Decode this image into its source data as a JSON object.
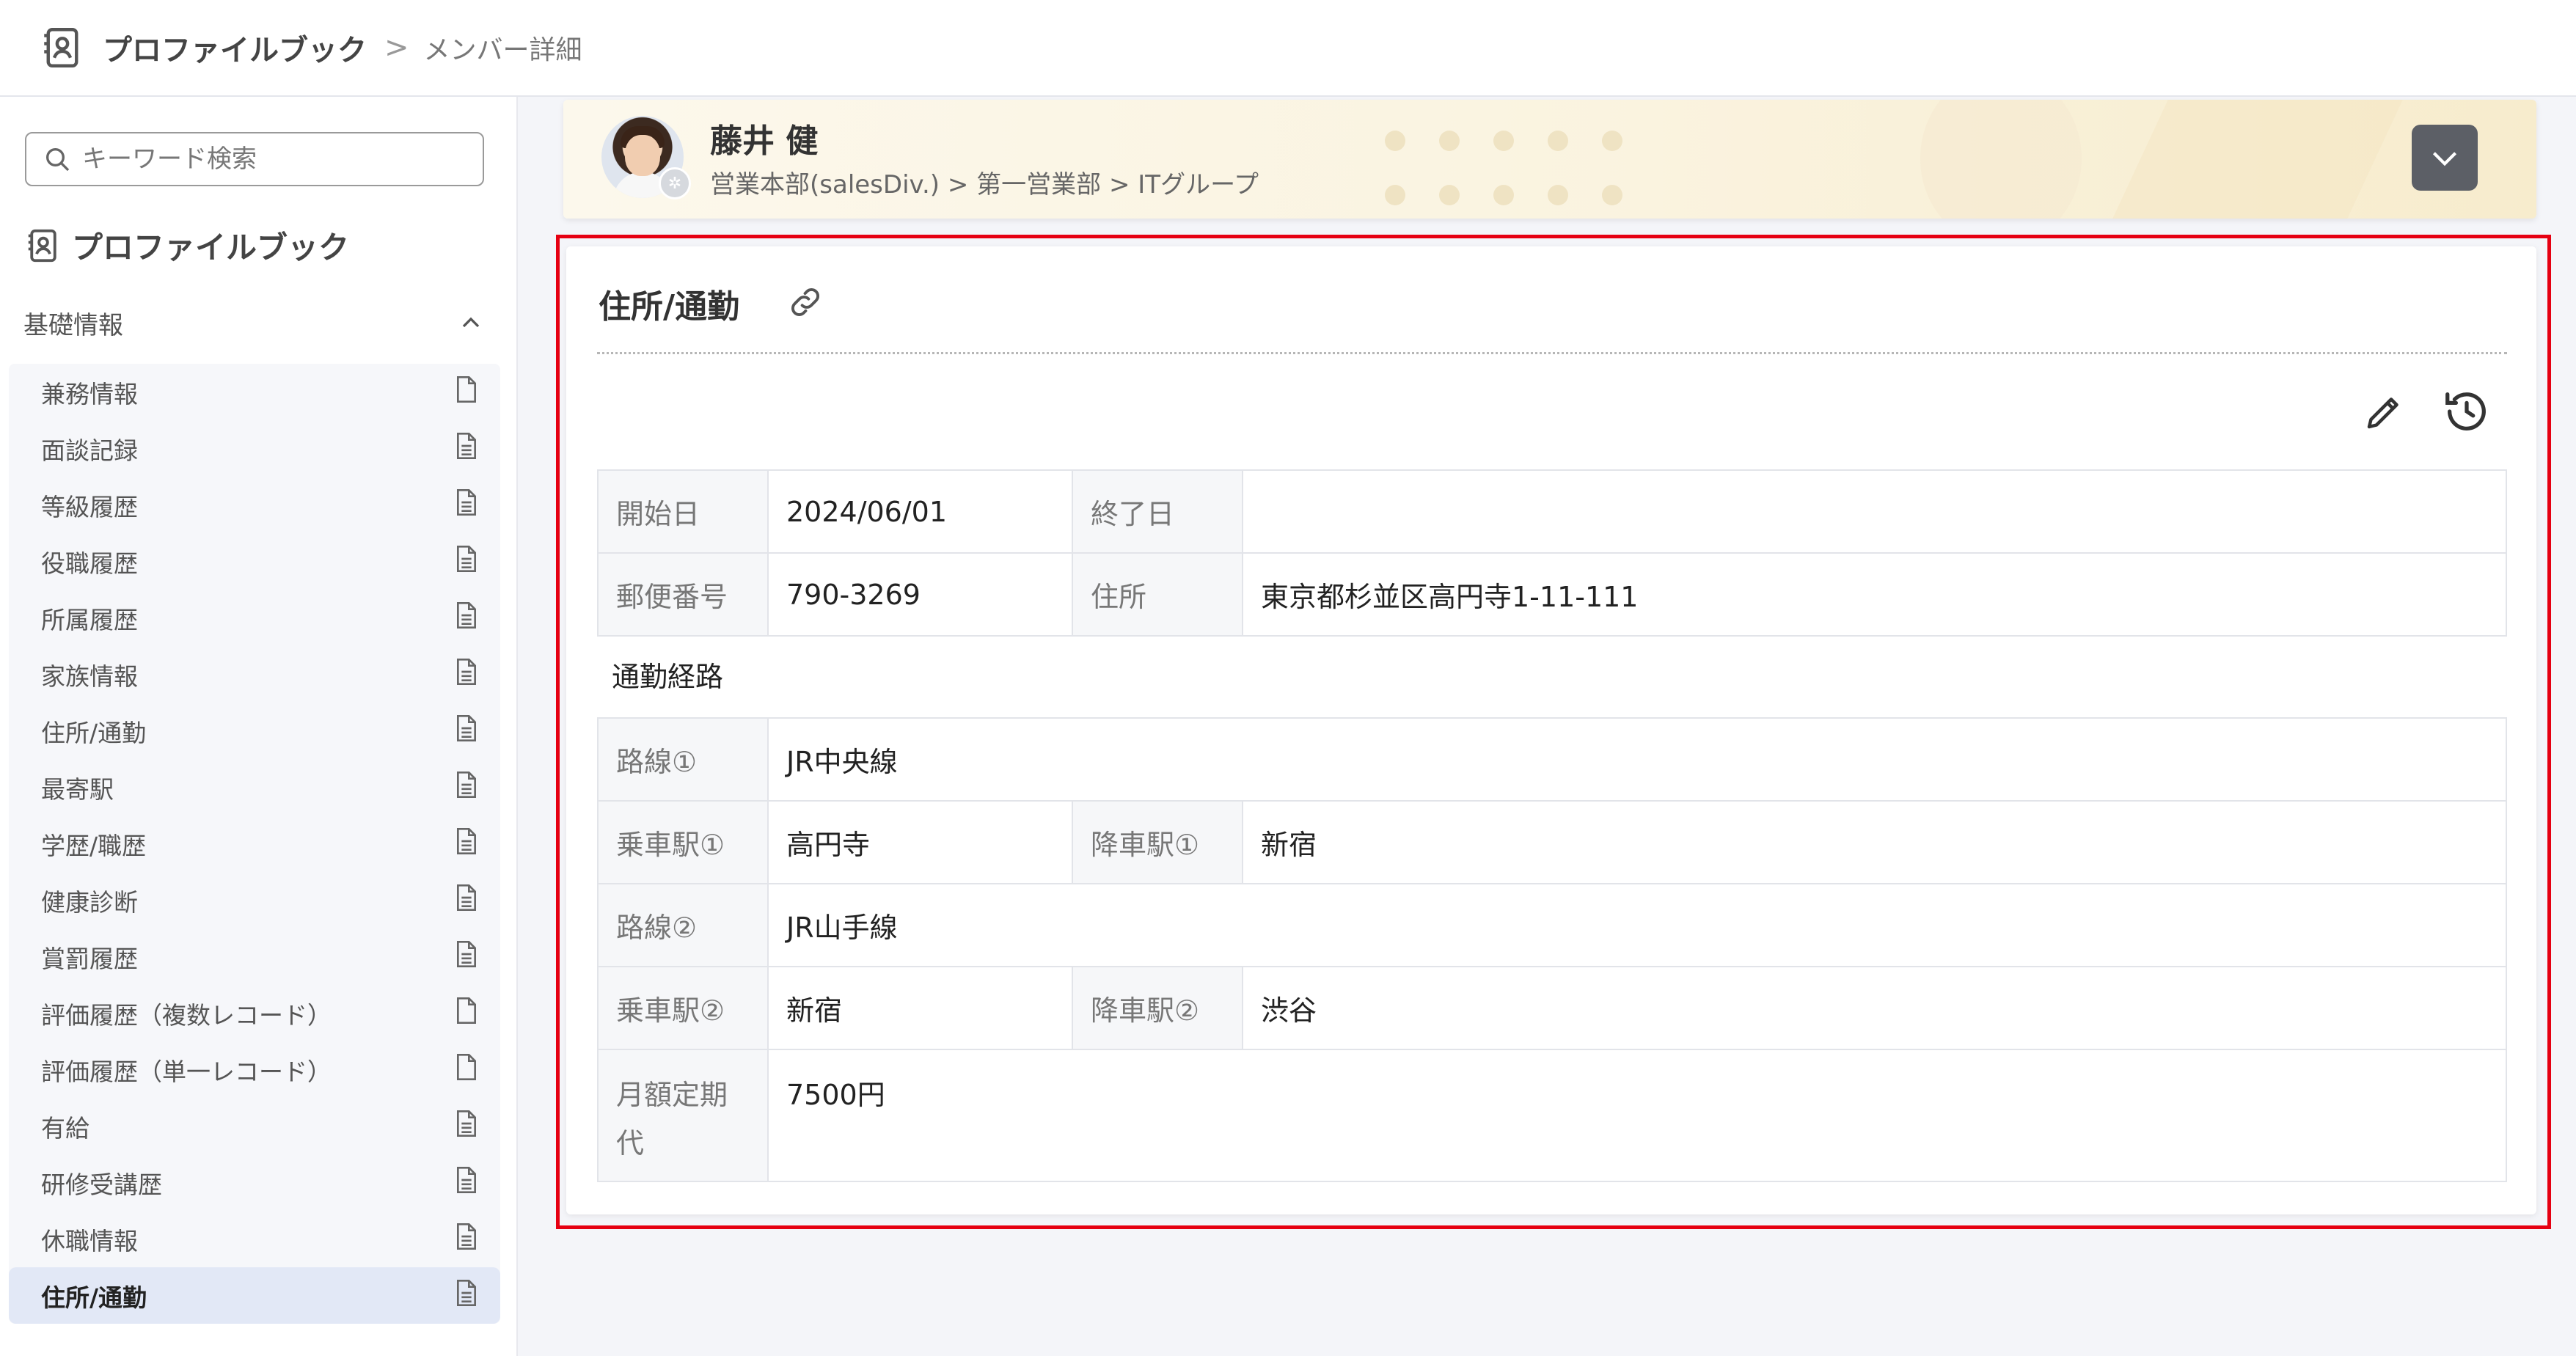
{
  "header": {
    "app_title": "プロファイルブック",
    "separator": ">",
    "current_page": "メンバー詳細"
  },
  "sidebar": {
    "search_placeholder": "キーワード検索",
    "title": "プロファイルブック",
    "group_label": "基礎情報",
    "items": [
      {
        "label": "兼務情報",
        "icon": "file-blank-icon"
      },
      {
        "label": "面談記録",
        "icon": "file-text-icon"
      },
      {
        "label": "等級履歴",
        "icon": "file-text-icon"
      },
      {
        "label": "役職履歴",
        "icon": "file-text-icon"
      },
      {
        "label": "所属履歴",
        "icon": "file-text-icon"
      },
      {
        "label": "家族情報",
        "icon": "file-text-icon"
      },
      {
        "label": "住所/通勤",
        "icon": "file-text-icon"
      },
      {
        "label": "最寄駅",
        "icon": "file-text-icon"
      },
      {
        "label": "学歴/職歴",
        "icon": "file-text-icon"
      },
      {
        "label": "健康診断",
        "icon": "file-text-icon"
      },
      {
        "label": "賞罰履歴",
        "icon": "file-text-icon"
      },
      {
        "label": "評価履歴（複数レコード）",
        "icon": "file-blank-icon"
      },
      {
        "label": "評価履歴（単一レコード）",
        "icon": "file-blank-icon"
      },
      {
        "label": "有給",
        "icon": "file-text-icon"
      },
      {
        "label": "研修受講歴",
        "icon": "file-text-icon"
      },
      {
        "label": "休職情報",
        "icon": "file-text-icon"
      },
      {
        "label": "住所/通勤",
        "icon": "file-text-icon",
        "active": true
      }
    ]
  },
  "profile": {
    "name": "藤井 健",
    "org_path": "営業本部(salesDiv.) > 第一営業部 > ITグループ"
  },
  "section": {
    "title": "住所/通勤",
    "basic": {
      "start_label": "開始日",
      "start_value": "2024/06/01",
      "end_label": "終了日",
      "end_value": "",
      "postal_label": "郵便番号",
      "postal_value": "790-3269",
      "address_label": "住所",
      "address_value": "東京都杉並区高円寺1-11-111"
    },
    "commute_heading": "通勤経路",
    "commute": {
      "route1_label": "路線①",
      "route1_value": "JR中央線",
      "board1_label": "乗車駅①",
      "board1_value": "高円寺",
      "alight1_label": "降車駅①",
      "alight1_value": "新宿",
      "route2_label": "路線②",
      "route2_value": "JR山手線",
      "board2_label": "乗車駅②",
      "board2_value": "新宿",
      "alight2_label": "降車駅②",
      "alight2_value": "渋谷",
      "pass_label": "月額定期代",
      "pass_value": "7500円"
    }
  },
  "colors": {
    "highlight": "#e60012",
    "active_nav": "#e2e8f6",
    "label_bg": "#f6f7f9"
  }
}
